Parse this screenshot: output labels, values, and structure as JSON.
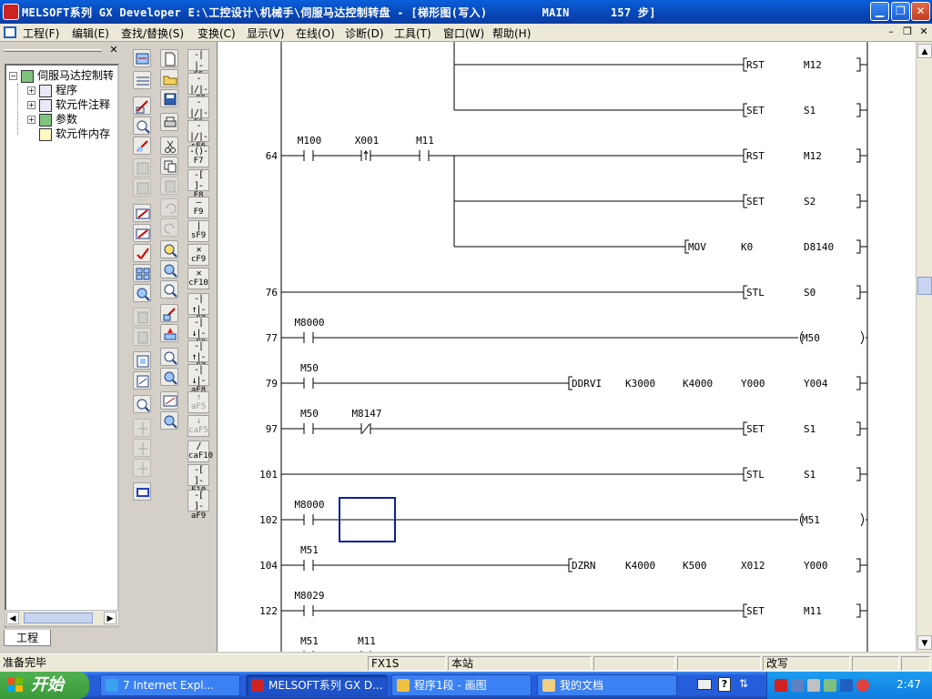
{
  "window": {
    "title": "MELSOFT系列 GX Developer E:\\工控设计\\机械手\\伺服马达控制转盘 - [梯形图(写入)        MAIN      157 步]"
  },
  "menubar": {
    "items": [
      "工程(F)",
      "编辑(E)",
      "查找/替换(S)",
      "变换(C)",
      "显示(V)",
      "在线(O)",
      "诊断(D)",
      "工具(T)",
      "窗口(W)",
      "帮助(H)"
    ]
  },
  "project_tree": {
    "root": "伺服马达控制转",
    "children": [
      "程序",
      "软元件注释",
      "参数",
      "软元件内存"
    ],
    "tab_label": "工程"
  },
  "function_keys": [
    {
      "sym": "-| |-",
      "key": "F5"
    },
    {
      "sym": "-|/|-",
      "key": "sF5"
    },
    {
      "sym": "-|/|-",
      "key": "F6"
    },
    {
      "sym": "-|/|-",
      "key": "sF6"
    },
    {
      "sym": "-()-",
      "key": "F7"
    },
    {
      "sym": "-[ ]-",
      "key": "F8"
    },
    {
      "sym": "—",
      "key": "F9"
    },
    {
      "sym": "|",
      "key": "sF9"
    },
    {
      "sym": "✕",
      "key": "cF9"
    },
    {
      "sym": "✕",
      "key": "cF10"
    },
    {
      "sym": "-|↑|-",
      "key": "sF7"
    },
    {
      "sym": "-|↓|-",
      "key": "sF8"
    },
    {
      "sym": "-|↑|-",
      "key": "aF7"
    },
    {
      "sym": "-|↓|-",
      "key": "aF8"
    },
    {
      "sym": "↑",
      "key": "aF5"
    },
    {
      "sym": "↓",
      "key": "caF5"
    },
    {
      "sym": "/",
      "key": "caF10"
    },
    {
      "sym": "-[ ]-",
      "key": "F10"
    },
    {
      "sym": "-[ ]-",
      "key": "aF9"
    }
  ],
  "ladder": {
    "rungs": [
      {
        "step": "",
        "contacts": [],
        "output": {
          "type": "box",
          "text": "RST",
          "args": [
            "M12"
          ]
        }
      },
      {
        "step": "",
        "contacts": [],
        "output": {
          "type": "box",
          "text": "SET",
          "args": [
            "S1"
          ]
        }
      },
      {
        "step": "64",
        "contacts": [
          {
            "name": "M100",
            "kind": "no"
          },
          {
            "name": "X001",
            "kind": "pulse"
          },
          {
            "name": "M11",
            "kind": "no"
          }
        ],
        "output": {
          "type": "box",
          "text": "RST",
          "args": [
            "M12"
          ]
        }
      },
      {
        "step": "",
        "contacts": [],
        "output": {
          "type": "box",
          "text": "SET",
          "args": [
            "S2"
          ]
        }
      },
      {
        "step": "",
        "contacts": [],
        "output": {
          "type": "box",
          "text": "MOV",
          "args": [
            "K0",
            "D8140"
          ]
        }
      },
      {
        "step": "76",
        "contacts": [],
        "output": {
          "type": "box",
          "text": "STL",
          "args": [
            "S0"
          ]
        }
      },
      {
        "step": "77",
        "contacts": [
          {
            "name": "M8000",
            "kind": "no"
          }
        ],
        "output": {
          "type": "coil",
          "text": "M50",
          "args": []
        }
      },
      {
        "step": "79",
        "contacts": [
          {
            "name": "M50",
            "kind": "no"
          }
        ],
        "output": {
          "type": "box",
          "text": "DDRVI",
          "args": [
            "K3000",
            "K4000",
            "Y000",
            "Y004"
          ]
        }
      },
      {
        "step": "97",
        "contacts": [
          {
            "name": "M50",
            "kind": "no"
          },
          {
            "name": "M8147",
            "kind": "nc"
          }
        ],
        "output": {
          "type": "box",
          "text": "SET",
          "args": [
            "S1"
          ]
        }
      },
      {
        "step": "101",
        "contacts": [],
        "output": {
          "type": "box",
          "text": "STL",
          "args": [
            "S1"
          ]
        }
      },
      {
        "step": "102",
        "contacts": [
          {
            "name": "M8000",
            "kind": "no"
          }
        ],
        "output": {
          "type": "coil",
          "text": "M51",
          "args": []
        }
      },
      {
        "step": "104",
        "contacts": [
          {
            "name": "M51",
            "kind": "no"
          }
        ],
        "output": {
          "type": "box",
          "text": "DZRN",
          "args": [
            "K4000",
            "K500",
            "X012",
            "Y000"
          ]
        }
      },
      {
        "step": "122",
        "contacts": [
          {
            "name": "M8029",
            "kind": "no"
          }
        ],
        "output": {
          "type": "box",
          "text": "SET",
          "args": [
            "M11"
          ]
        }
      },
      {
        "step": "",
        "contacts": [
          {
            "name": "M51",
            "kind": "no"
          },
          {
            "name": "M11",
            "kind": "no"
          }
        ],
        "output": null
      }
    ]
  },
  "statusbar": {
    "ready": "准备完毕",
    "plc": "FX1S",
    "station": "本站",
    "mode": "改写"
  },
  "taskbar": {
    "start": "开始",
    "tasks": [
      "7 Internet Expl...",
      "MELSOFT系列 GX D...",
      "程序1段 - 画图",
      "我的文档"
    ],
    "clock": "2:47"
  }
}
